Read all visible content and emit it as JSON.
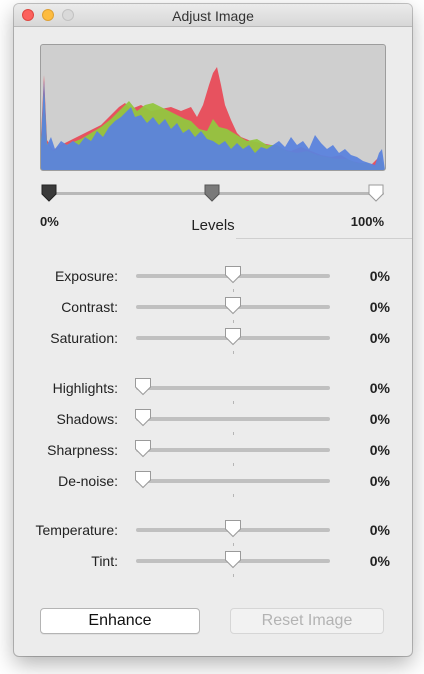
{
  "window": {
    "title": "Adjust Image"
  },
  "histogram": {
    "colors": {
      "red": "#e84b58",
      "green": "#92c63f",
      "blue": "#5b83dd",
      "background": "#cfcfcf"
    }
  },
  "levels": {
    "min_label": "0%",
    "max_label": "100%",
    "title": "Levels",
    "black_point": 0.0,
    "midtone": 0.5,
    "white_point": 1.0
  },
  "adjustments": [
    {
      "label": "Exposure:",
      "value": "0%",
      "level": 0.5
    },
    {
      "label": "Contrast:",
      "value": "0%",
      "level": 0.5
    },
    {
      "label": "Saturation:",
      "value": "0%",
      "level": 0.5
    },
    {
      "label": "Highlights:",
      "value": "0%",
      "level": 0.0
    },
    {
      "label": "Shadows:",
      "value": "0%",
      "level": 0.0
    },
    {
      "label": "Sharpness:",
      "value": "0%",
      "level": 0.0
    },
    {
      "label": "De-noise:",
      "value": "0%",
      "level": 0.0
    },
    {
      "label": "Temperature:",
      "value": "0%",
      "level": 0.5
    },
    {
      "label": "Tint:",
      "value": "0%",
      "level": 0.5
    }
  ],
  "buttons": {
    "enhance": "Enhance",
    "reset": "Reset Image"
  }
}
